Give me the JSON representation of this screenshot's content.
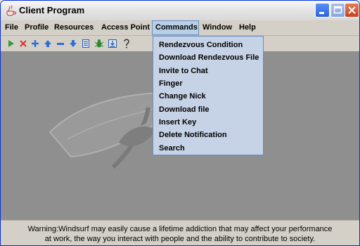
{
  "window": {
    "title": "Client Program",
    "controls": {
      "minimize": "minimize",
      "maximize": "maximize",
      "close": "close"
    }
  },
  "menubar": {
    "items": [
      "File",
      "Profile",
      "Resources",
      "Access Point",
      "Commands",
      "Window",
      "Help"
    ],
    "active": "Commands"
  },
  "commands_menu": {
    "items": [
      "Rendezvous Condition",
      "Download Rendezvous File",
      "Invite to Chat",
      "Finger",
      "Change Nick",
      "Download file",
      "Insert Key",
      "Delete Notification",
      "Search"
    ]
  },
  "toolbar": {
    "icons": [
      "play-icon",
      "delete-icon",
      "add-icon",
      "up-arrow-icon",
      "minus-icon",
      "down-arrow-icon",
      "document-icon",
      "bug-icon",
      "download-icon",
      "help-icon"
    ]
  },
  "status": {
    "line1": "Warning:Windsurf may easily cause a lifetime addiction that may affect your performance",
    "line2": "at work, the way you interact with people and the ability to contribute to society."
  },
  "colors": {
    "title_gradient_top": "#f7f7f7",
    "menu_active_bg": "#b8cfe5",
    "dropdown_bg": "#c6d3e6",
    "content_bg": "#8f8f8f",
    "close_button": "#c8431d"
  }
}
